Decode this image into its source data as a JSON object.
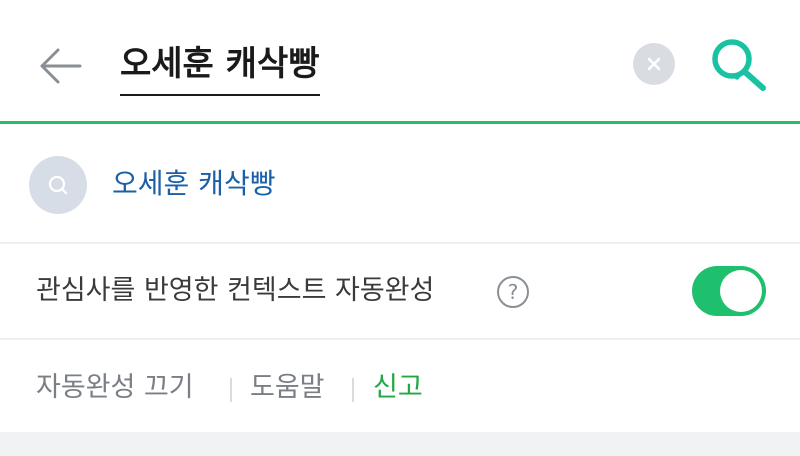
{
  "search": {
    "query": "오세훈 캐삭빵",
    "accent_color": "#1ec06e"
  },
  "suggestion": {
    "text": "오세훈 캐삭빵"
  },
  "context": {
    "label": "관심사를 반영한 컨텍스트 자동완성",
    "help": "?",
    "toggle_on": true
  },
  "footer": {
    "turn_off": "자동완성 끄기",
    "help": "도움말",
    "report": "신고"
  },
  "icons": {
    "back": "arrow-left-icon",
    "clear": "close-icon",
    "search": "search-icon",
    "suggest": "search-icon"
  }
}
